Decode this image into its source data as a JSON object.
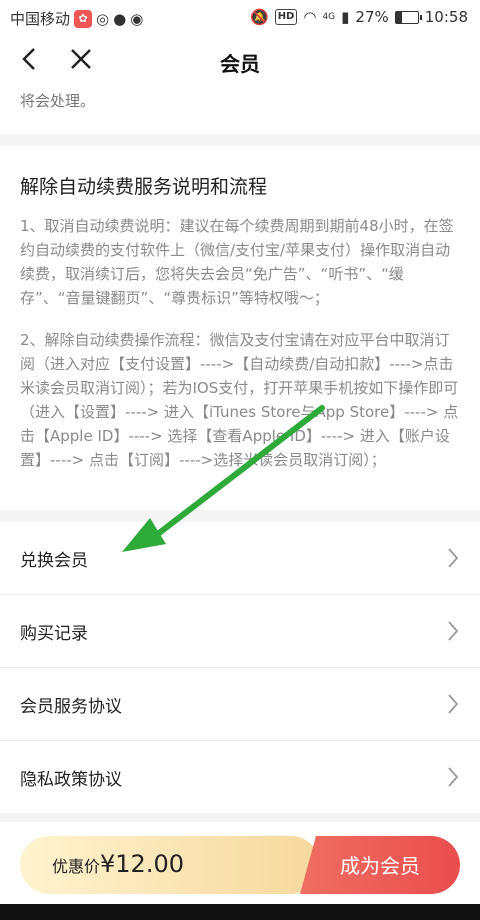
{
  "status_bar": {
    "carrier": "中国移动",
    "signal_label": "4G",
    "battery": "27%",
    "time": "10:58"
  },
  "nav": {
    "title": "会员"
  },
  "top_text": "将会处理。",
  "section": {
    "title": "解除自动续费服务说明和流程",
    "para1": "1、取消自动续费说明：建议在每个续费周期到期前48小时，在签约自动续费的支付软件上（微信/支付宝/苹果支付）操作取消自动续费，取消续订后，您将失去会员“免广告”、“听书”、“缓存”、“音量键翻页”、“尊贵标识”等特权哦～；",
    "para2": "2、解除自动续费操作流程：微信及支付宝请在对应平台中取消订阅（进入对应【支付设置】---->【自动续费/自动扣款】---->点击米读会员取消订阅）；若为IOS支付，打开苹果手机按如下操作即可（进入【设置】----> 进入【iTunes Store与App Store】----> 点击【Apple ID】----> 选择【查看Apple ID】----> 进入【账户设置】----> 点击【订阅】---->选择米读会员取消订阅）；"
  },
  "menu": [
    {
      "label": "兑换会员"
    },
    {
      "label": "购买记录"
    },
    {
      "label": "会员服务协议"
    },
    {
      "label": "隐私政策协议"
    }
  ],
  "bottom": {
    "price_prefix": "优惠价",
    "price": "¥12.00",
    "join": "成为会员"
  },
  "colors": {
    "accent_red": "#ea4d4d",
    "price_gold": "#f6d89d",
    "arrow_green": "#2eaa3a"
  }
}
